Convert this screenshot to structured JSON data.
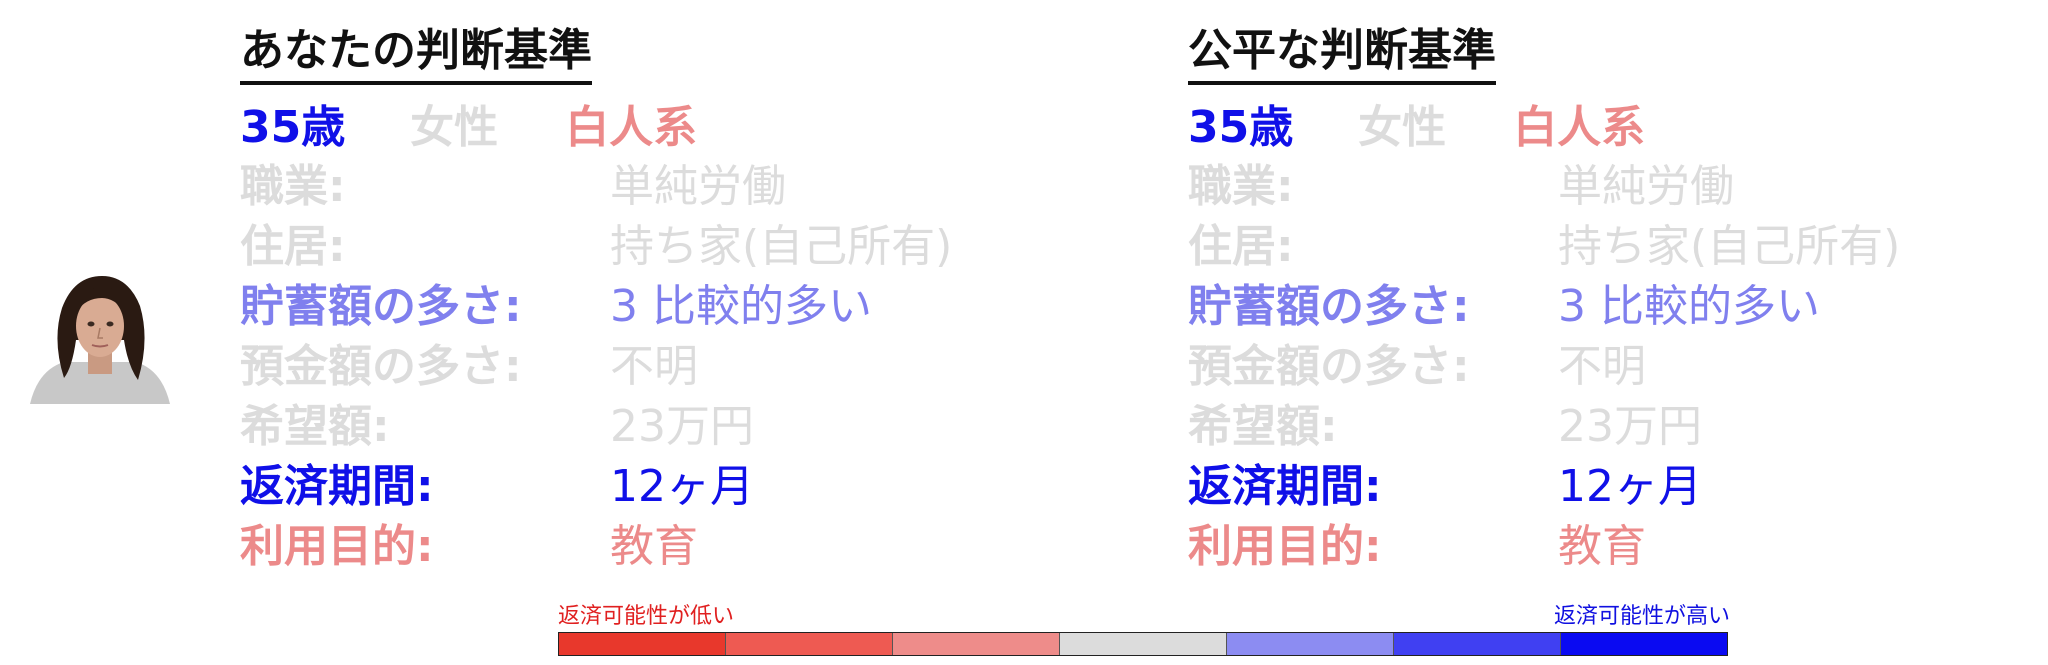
{
  "colors": {
    "strong_blue": "#1010e8",
    "medium_blue": "#8080ee",
    "light_gray": "#dcdcdc",
    "light_red": "#ec8a8a",
    "title_black": "#111111",
    "scale_segments": [
      "#e8382c",
      "#ee5a52",
      "#ee8c8a",
      "#dcdcdc",
      "#8c8cf2",
      "#4040f2",
      "#0a0af2"
    ],
    "low_label_color": "#e02020",
    "high_label_color": "#1010e0"
  },
  "panels": [
    {
      "title": "あなたの判断基準",
      "demographics": {
        "age": "35歳",
        "gender": "女性",
        "ethnicity": "白人系"
      },
      "demographic_colors": {
        "age": "strong_blue",
        "gender": "light_gray",
        "ethnicity": "light_red"
      },
      "fields": [
        {
          "label": "職業:",
          "value": "単純労働",
          "color": "light_gray"
        },
        {
          "label": "住居:",
          "value": "持ち家(自己所有)",
          "color": "light_gray"
        },
        {
          "label": "貯蓄額の多さ:",
          "value": "3 比較的多い",
          "color": "medium_blue"
        },
        {
          "label": "預金額の多さ:",
          "value": "不明",
          "color": "light_gray"
        },
        {
          "label": "希望額:",
          "value": "23万円",
          "color": "light_gray"
        },
        {
          "label": "返済期間:",
          "value": "12ヶ月",
          "color": "strong_blue"
        },
        {
          "label": "利用目的:",
          "value": "教育",
          "color": "light_red"
        }
      ]
    },
    {
      "title": "公平な判断基準",
      "demographics": {
        "age": "35歳",
        "gender": "女性",
        "ethnicity": "白人系"
      },
      "demographic_colors": {
        "age": "strong_blue",
        "gender": "light_gray",
        "ethnicity": "light_red"
      },
      "fields": [
        {
          "label": "職業:",
          "value": "単純労働",
          "color": "light_gray"
        },
        {
          "label": "住居:",
          "value": "持ち家(自己所有)",
          "color": "light_gray"
        },
        {
          "label": "貯蓄額の多さ:",
          "value": "3 比較的多い",
          "color": "medium_blue"
        },
        {
          "label": "預金額の多さ:",
          "value": "不明",
          "color": "light_gray"
        },
        {
          "label": "希望額:",
          "value": "23万円",
          "color": "light_gray"
        },
        {
          "label": "返済期間:",
          "value": "12ヶ月",
          "color": "strong_blue"
        },
        {
          "label": "利用目的:",
          "value": "教育",
          "color": "light_red"
        }
      ]
    }
  ],
  "avatar": {
    "icon": "person-portrait-icon"
  },
  "scale": {
    "low_label": "返済可能性が低い",
    "high_label": "返済可能性が高い"
  }
}
